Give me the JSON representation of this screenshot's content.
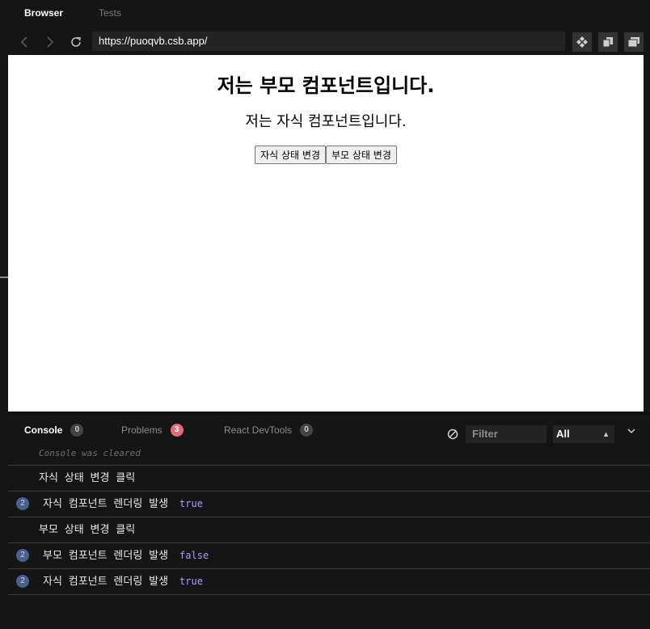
{
  "topbar": {
    "tabs": [
      {
        "label": "Browser"
      },
      {
        "label": "Tests"
      }
    ]
  },
  "nav": {
    "url": "https://puoqvb.csb.app/"
  },
  "preview": {
    "parent_heading": "저는 부모 컴포넌트입니다.",
    "child_heading": "저는 자식 컴포넌트입니다.",
    "child_button": "자식 상태 변경",
    "parent_button": "부모 상태 변경"
  },
  "console": {
    "tabs": [
      {
        "label": "Console",
        "count": "0"
      },
      {
        "label": "Problems",
        "count": "3"
      },
      {
        "label": "React DevTools",
        "count": "0"
      }
    ],
    "filter_placeholder": "Filter",
    "level": "All",
    "cleared": "Console was cleared",
    "rows": [
      {
        "message": "자식 상태 변경 클릭"
      },
      {
        "count": "2",
        "message": "자식 컴포넌트 렌더링 발생",
        "value": "true"
      },
      {
        "message": "부모 상태 변경 클릭"
      },
      {
        "count": "2",
        "message": "부모 컴포넌트 렌더링 발생",
        "value": "false"
      },
      {
        "count": "2",
        "message": "자식 컴포넌트 렌더링 발생",
        "value": "true"
      }
    ]
  },
  "colors": {
    "badge_red": "#e06c75",
    "value_purple": "#a99cff",
    "count_blue": "#4a5f8e"
  },
  "icons": [
    "back-icon",
    "forward-icon",
    "reload-icon",
    "move-icon",
    "copy-icon",
    "new-window-icon",
    "clear-icon",
    "chevron-down-icon"
  ]
}
